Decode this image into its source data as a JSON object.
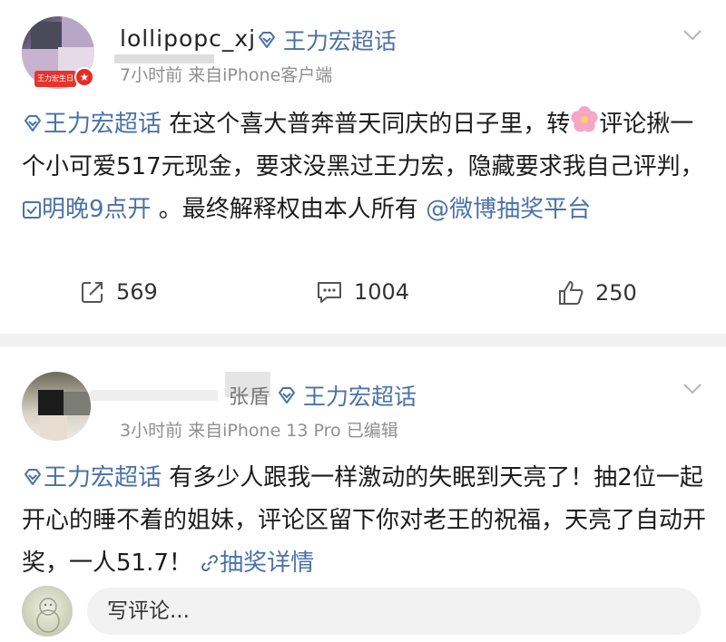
{
  "posts": [
    {
      "username_visible": "lollipopc_xj",
      "topic": "王力宏超话",
      "meta": "7小时前  来自iPhone客户端",
      "avatar_badge": "王力宏生日快乐",
      "content": {
        "topic": "王力宏超话",
        "text1": " 在这个喜大普奔普天同庆的日子里，转",
        "text2": "评论揪一个小可爱517元现金，要求没黑过王力宏，隐藏要求我自己评判，",
        "schedule_link": "明晚9点开",
        "text3": " 。最终解释权由本人所有 ",
        "mention": "@微博抽奖平台"
      },
      "stats": {
        "reposts": "569",
        "comments": "1004",
        "likes": "250"
      }
    },
    {
      "username_visible": "张盾",
      "topic": "王力宏超话",
      "meta": "3小时前  来自iPhone 13 Pro  已编辑",
      "content": {
        "topic": "王力宏超话",
        "text1": " 有多少人跟我一样激动的失眠到天亮了！抽2位一起开心的睡不着的姐妹，评论区留下你对老王的祝福，天亮了自动开奖，一人51.7！ ",
        "lottery_link": "抽奖详情"
      }
    }
  ],
  "comment_input": {
    "placeholder": "写评论..."
  },
  "colors": {
    "link": "#4a72a8",
    "meta": "#8f8f8f",
    "separator": "#f1f1f1",
    "vip_red": "#e62b22"
  }
}
